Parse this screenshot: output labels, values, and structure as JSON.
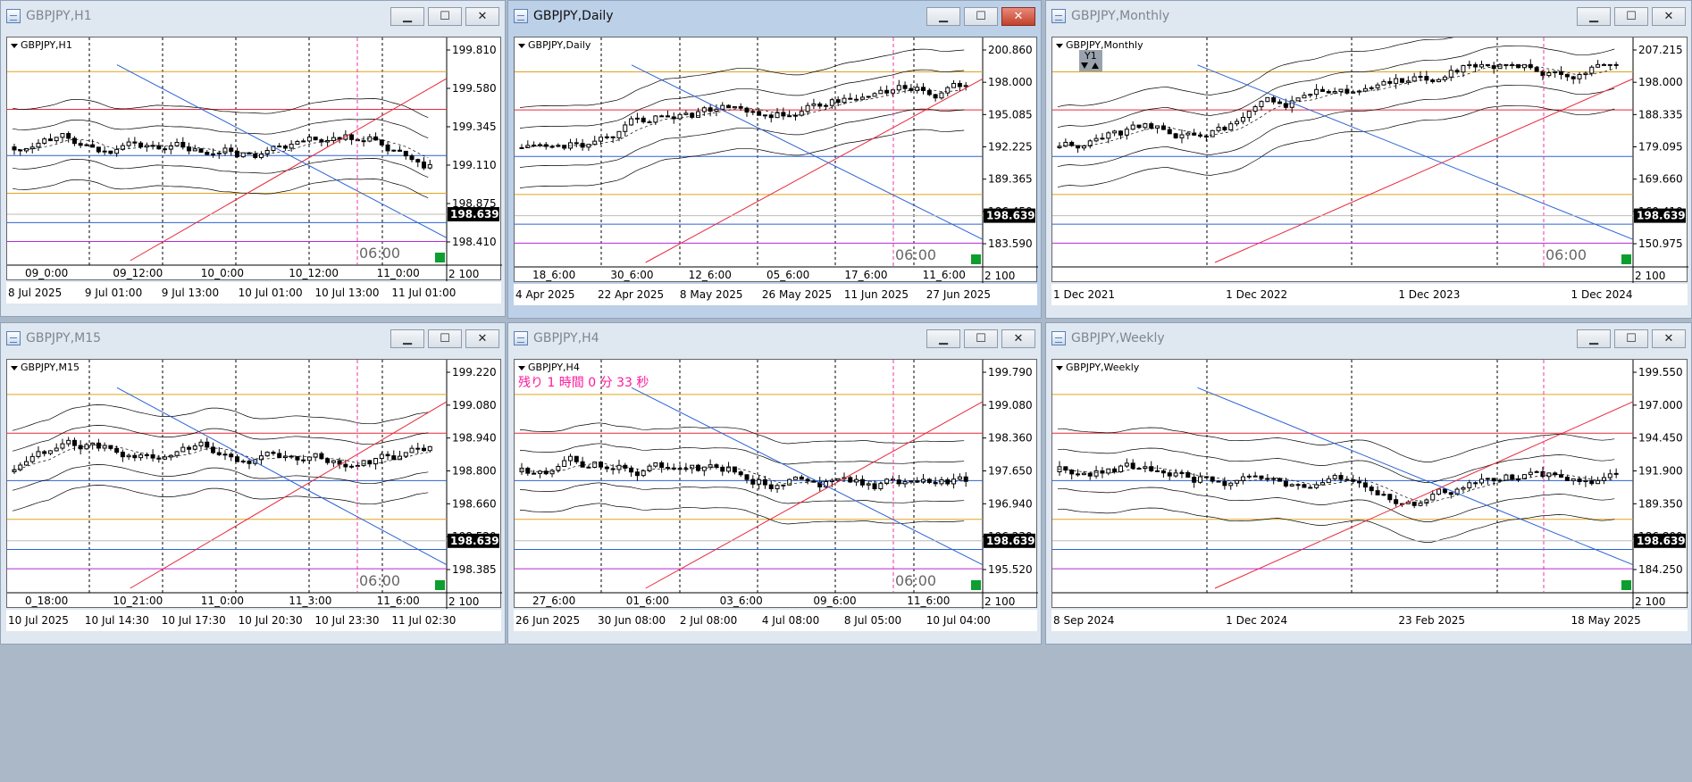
{
  "colors": {
    "gold": "#e0a21c",
    "red": "#e8283a",
    "blue": "#2a62d6",
    "magenta": "#b629d6",
    "pink": "#e83aa0",
    "price_box": "#000000",
    "band": "#000000",
    "green_box": "#0c9e2f"
  },
  "current_price": "198.639",
  "windows": [
    {
      "id": "h1",
      "title": "GBPJPY,H1",
      "chart_label": "GBPJPY,H1",
      "active": false,
      "y_ticks": [
        "199.810",
        "199.580",
        "199.345",
        "199.110",
        "198.875",
        "198.410"
      ],
      "x_ticks": [
        "09_0:00",
        "09_12:00",
        "10_0:00",
        "10_12:00",
        "11_0:00"
      ],
      "dates": [
        "8 Jul 2025",
        "9 Jul 01:00",
        "9 Jul 13:00",
        "10 Jul 01:00",
        "10 Jul 13:00",
        "11 Jul 01:00"
      ],
      "tag": "06:00",
      "small": "2",
      "small2": "100",
      "countdown": "",
      "icons": ""
    },
    {
      "id": "daily",
      "title": "GBPJPY,Daily",
      "chart_label": "GBPJPY,Daily",
      "active": true,
      "y_ticks": [
        "200.860",
        "198.000",
        "195.085",
        "192.225",
        "189.365",
        "186.450",
        "183.590"
      ],
      "x_ticks": [
        "18_6:00",
        "30_6:00",
        "12_6:00",
        "05_6:00",
        "17_6:00",
        "11_6:00"
      ],
      "dates": [
        "4 Apr 2025",
        "22 Apr 2025",
        "8 May 2025",
        "26 May 2025",
        "11 Jun 2025",
        "27 Jun 2025"
      ],
      "tag": "06:00",
      "small": "2",
      "small2": "100",
      "countdown": "",
      "icons": ""
    },
    {
      "id": "monthly",
      "title": "GBPJPY,Monthly",
      "chart_label": "GBPJPY,Monthly",
      "active": false,
      "y_ticks": [
        "207.215",
        "198.000",
        "188.335",
        "179.095",
        "169.660",
        "160.410",
        "150.975"
      ],
      "x_ticks": [],
      "dates": [
        "1 Dec 2021",
        "1 Dec 2022",
        "1 Dec 2023",
        "1 Dec 2024"
      ],
      "tag": "06:00",
      "small": "2",
      "small2": "100",
      "countdown": "",
      "icons": "Y1"
    },
    {
      "id": "m15",
      "title": "GBPJPY,M15",
      "chart_label": "GBPJPY,M15",
      "active": false,
      "y_ticks": [
        "199.220",
        "199.080",
        "198.940",
        "198.800",
        "198.660",
        "198.520",
        "198.385"
      ],
      "x_ticks": [
        "0_18:00",
        "10_21:00",
        "11_0:00",
        "11_3:00",
        "11_6:00"
      ],
      "dates": [
        "10 Jul 2025",
        "10 Jul 14:30",
        "10 Jul 17:30",
        "10 Jul 20:30",
        "10 Jul 23:30",
        "11 Jul 02:30"
      ],
      "tag": "06:00",
      "small": "2",
      "small2": "100",
      "countdown": "",
      "icons": ""
    },
    {
      "id": "h4",
      "title": "GBPJPY,H4",
      "chart_label": "GBPJPY,H4",
      "active": false,
      "y_ticks": [
        "199.790",
        "199.080",
        "198.360",
        "197.650",
        "196.940",
        "196.230",
        "195.520"
      ],
      "x_ticks": [
        "27_6:00",
        "01_6:00",
        "03_6:00",
        "09_6:00",
        "11_6:00"
      ],
      "dates": [
        "26 Jun 2025",
        "30 Jun 08:00",
        "2 Jul 08:00",
        "4 Jul 08:00",
        "8 Jul 05:00",
        "10 Jul 04:00"
      ],
      "tag": "06:00",
      "small": "2",
      "small2": "100",
      "countdown": "残り 1 時間 0 分 33 秒",
      "icons": ""
    },
    {
      "id": "weekly",
      "title": "GBPJPY,Weekly",
      "chart_label": "GBPJPY,Weekly",
      "active": false,
      "y_ticks": [
        "199.550",
        "197.000",
        "194.450",
        "191.900",
        "189.350",
        "186.800",
        "184.250"
      ],
      "x_ticks": [],
      "dates": [
        "8 Sep 2024",
        "1 Dec 2024",
        "23 Feb 2025",
        "18 May 2025"
      ],
      "tag": "",
      "small": "2",
      "small2": "100",
      "countdown": "",
      "icons": ""
    }
  ]
}
